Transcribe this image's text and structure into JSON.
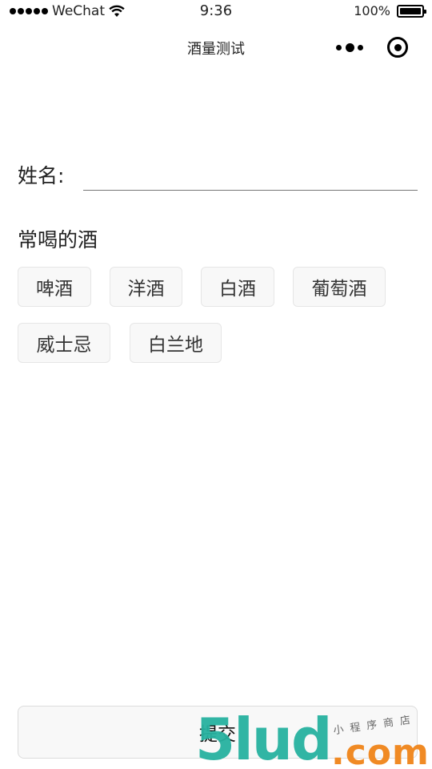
{
  "status_bar": {
    "carrier": "WeChat",
    "time": "9:36",
    "battery_text": "100%",
    "battery_level": 1.0
  },
  "nav": {
    "title": "酒量测试"
  },
  "form": {
    "name_label": "姓名:",
    "name_value": "",
    "drinks_title": "常喝的酒",
    "drinks": [
      "啤酒",
      "洋酒",
      "白酒",
      "葡萄酒",
      "威士忌",
      "白兰地"
    ],
    "submit_label": "提交"
  },
  "watermark": {
    "brand": "5lud",
    "domain": ".com",
    "tagline": "小程序商店"
  },
  "colors": {
    "watermark_teal": "#27b2a0",
    "watermark_orange": "#f08a24",
    "chip_bg": "#f8f8f8"
  }
}
